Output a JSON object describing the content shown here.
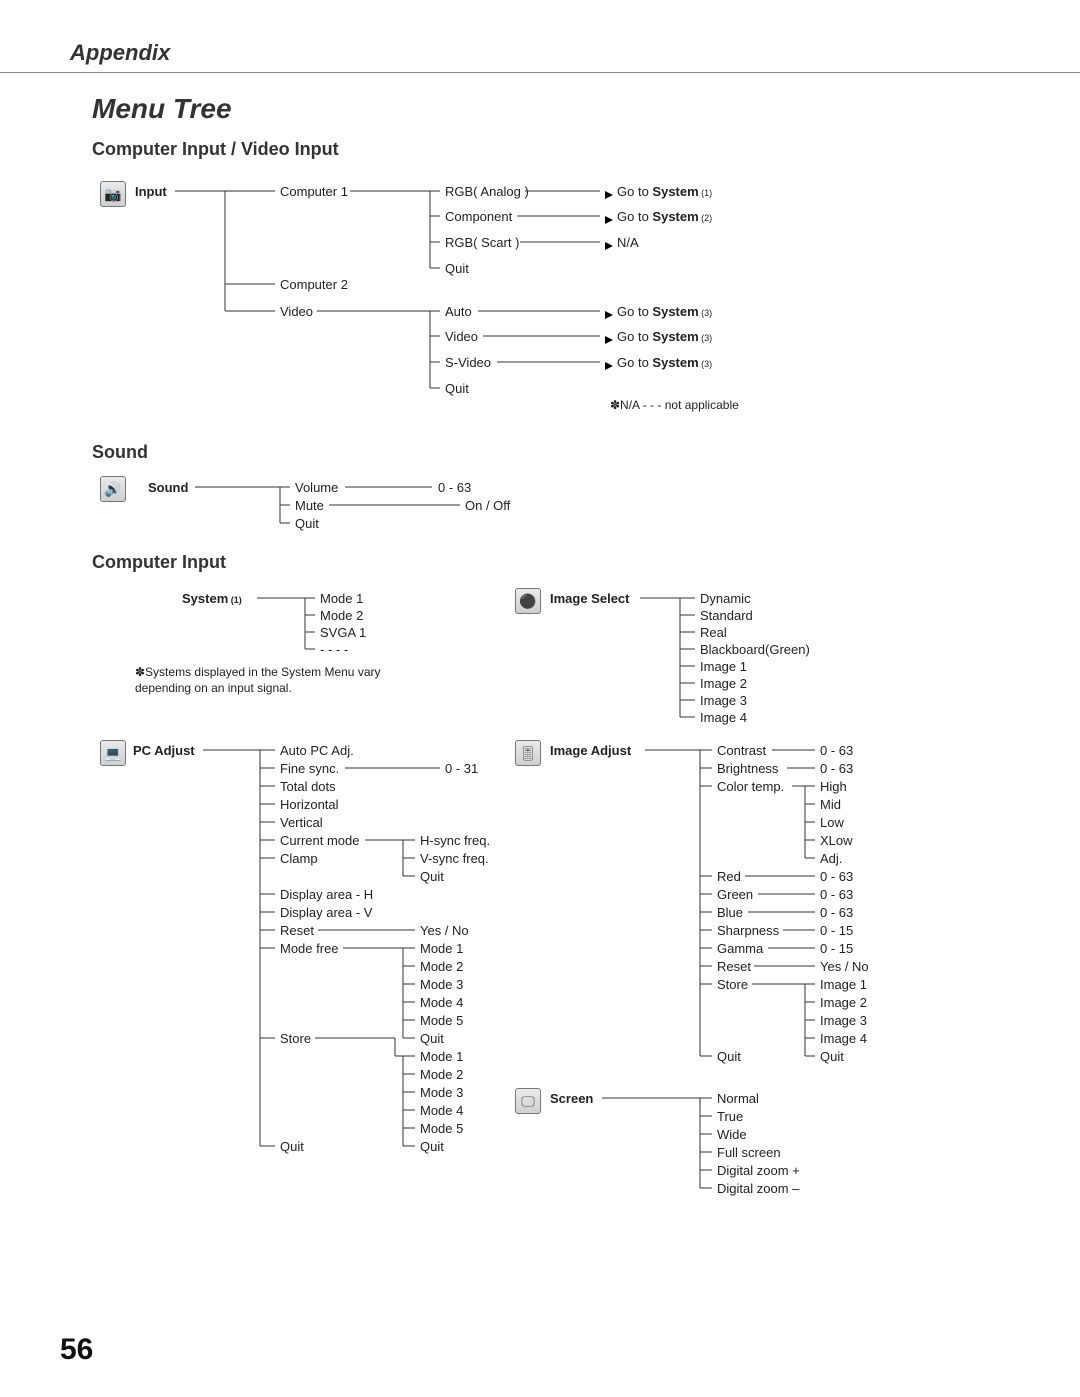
{
  "header": {
    "appendix": "Appendix"
  },
  "title": "Menu Tree",
  "pageNumber": "56",
  "sections": {
    "inputVideo": "Computer Input / Video Input",
    "sound": "Sound",
    "computerInput": "Computer Input"
  },
  "input": {
    "label": "Input",
    "items": {
      "computer1": "Computer 1",
      "computer2": "Computer 2",
      "video": "Video",
      "rgbAnalog": "RGB( Analog )",
      "component": "Component",
      "rgbScart": "RGB( Scart )",
      "quit1": "Quit",
      "autoV": "Auto",
      "videoV": "Video",
      "svideo": "S-Video",
      "quit2": "Quit",
      "goto1a": "Go to ",
      "goto1b": "System",
      "ref1": " (1)",
      "goto2b": "System",
      "ref2": " (2)",
      "na": "N/A",
      "goto3b": "System",
      "ref3": " (3)",
      "footnote": "✽N/A - - - not applicable"
    }
  },
  "sound": {
    "label": "Sound",
    "volume": "Volume",
    "mute": "Mute",
    "quit": "Quit",
    "volRange": "0 - 63",
    "muteVal": "On / Off"
  },
  "system": {
    "label": "System",
    "ref": " (1)",
    "mode1": "Mode 1",
    "mode2": "Mode 2",
    "svga1": "SVGA 1",
    "dashes": "- - - -",
    "note": "✽Systems displayed in the System Menu vary depending on an input signal."
  },
  "pcAdjust": {
    "label": "PC Adjust",
    "autoPc": "Auto PC Adj.",
    "fineSync": "Fine sync.",
    "fineSyncRange": "0 - 31",
    "totalDots": "Total dots",
    "horizontal": "Horizontal",
    "vertical": "Vertical",
    "currentMode": "Current mode",
    "hsync": "H-sync freq.",
    "vsync": "V-sync freq.",
    "clamp": "Clamp",
    "quitC": "Quit",
    "displayH": "Display area - H",
    "displayV": "Display area - V",
    "reset": "Reset",
    "yesNo": "Yes / No",
    "modeFree": "Mode free",
    "m1": "Mode 1",
    "m2": "Mode 2",
    "m3": "Mode 3",
    "m4": "Mode 4",
    "m5": "Mode 5",
    "qm": "Quit",
    "store": "Store",
    "sm1": "Mode 1",
    "sm2": "Mode 2",
    "sm3": "Mode 3",
    "sm4": "Mode 4",
    "sm5": "Mode 5",
    "sqm": "Quit",
    "quit": "Quit"
  },
  "imageSelect": {
    "label": "Image Select",
    "dynamic": "Dynamic",
    "standard": "Standard",
    "real": "Real",
    "blackboard": "Blackboard(Green)",
    "img1": "Image 1",
    "img2": "Image 2",
    "img3": "Image 3",
    "img4": "Image 4"
  },
  "imageAdjust": {
    "label": "Image Adjust",
    "contrast": "Contrast",
    "contrastR": "0 - 63",
    "brightness": "Brightness",
    "brightnessR": "0 - 63",
    "colorTemp": "Color temp.",
    "high": "High",
    "mid": "Mid",
    "low": "Low",
    "xlow": "XLow",
    "adj": "Adj.",
    "red": "Red",
    "redR": "0 - 63",
    "green": "Green",
    "greenR": "0 - 63",
    "blue": "Blue",
    "blueR": "0 - 63",
    "sharpness": "Sharpness",
    "sharpnessR": "0 - 15",
    "gamma": "Gamma",
    "gammaR": "0 - 15",
    "reset": "Reset",
    "resetR": "Yes / No",
    "store": "Store",
    "simg1": "Image 1",
    "simg2": "Image 2",
    "simg3": "Image 3",
    "simg4": "Image 4",
    "squit": "Quit",
    "quit": "Quit"
  },
  "screen": {
    "label": "Screen",
    "normal": "Normal",
    "true": "True",
    "wide": "Wide",
    "full": "Full screen",
    "dzp": "Digital zoom +",
    "dzm": "Digital zoom –"
  }
}
